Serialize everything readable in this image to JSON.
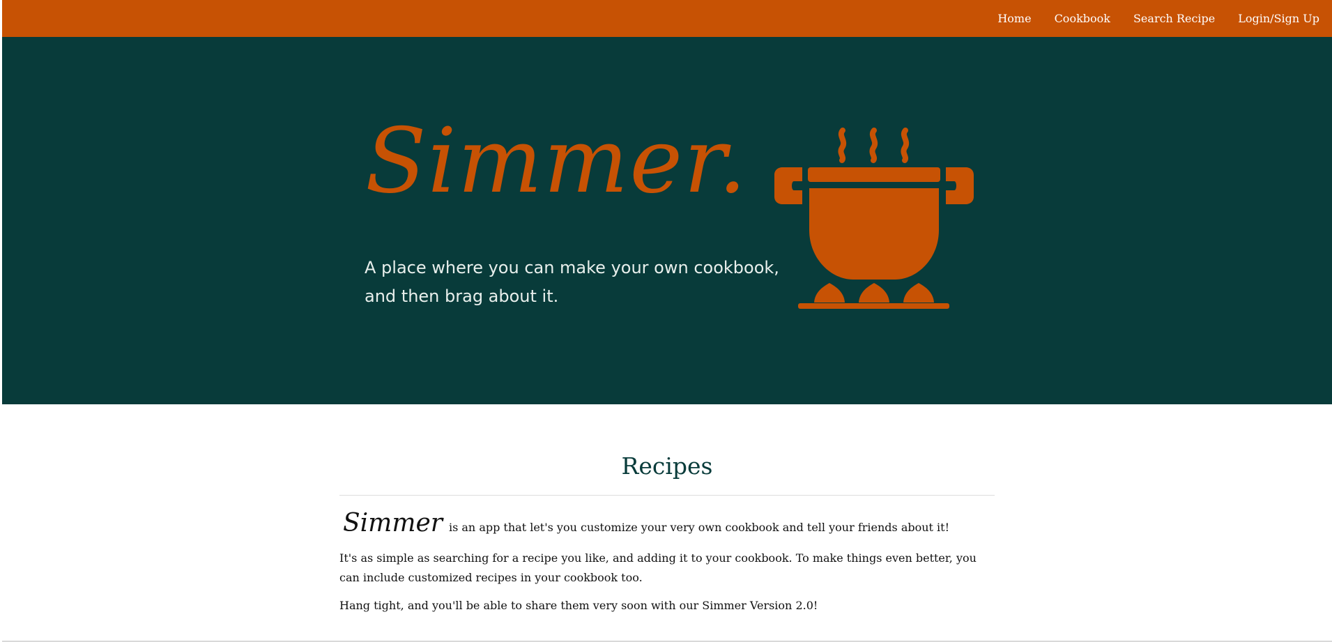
{
  "nav": {
    "links": [
      "Home",
      "Cookbook",
      "Search Recipe",
      "Login/Sign Up"
    ]
  },
  "hero": {
    "title": "Simmer.",
    "tagline": "A place where you can make your own cookbook, and then brag about it.",
    "icon": "cooking-pot-icon"
  },
  "recipes": {
    "heading": "Recipes",
    "brand": "Simmer",
    "intro": "is an app that let's you customize your very own cookbook and tell your friends about it!",
    "paragraphs": [
      "It's as simple as searching for a recipe you like, and adding it to your cookbook. To make things even better, you can include customized recipes in your cookbook too.",
      "Hang tight, and you'll be able to share them very soon with our Simmer Version 2.0!"
    ]
  },
  "colors": {
    "orange": "#c75204",
    "dark_teal": "#083b3a",
    "white": "#ffffff",
    "text": "#111111"
  }
}
